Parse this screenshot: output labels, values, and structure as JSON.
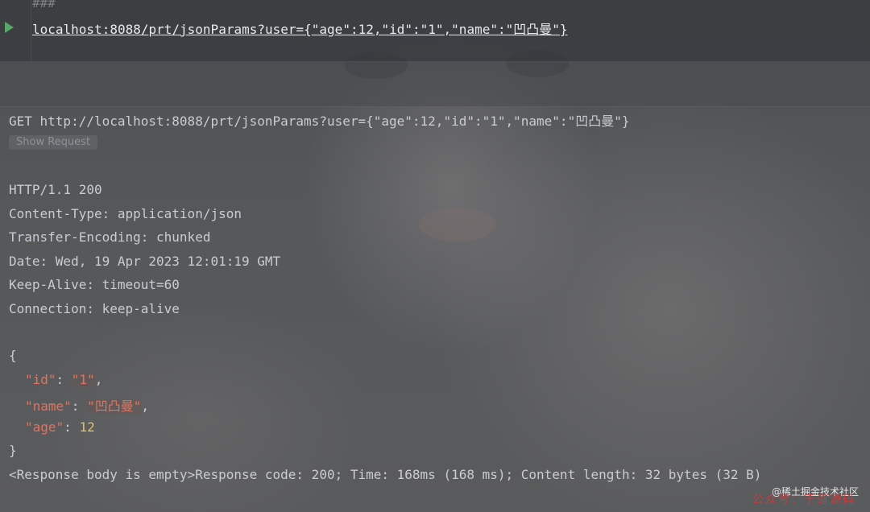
{
  "editor": {
    "comment": "###",
    "request_line": "localhost:8088/prt/jsonParams?user={\"age\":12,\"id\":\"1\",\"name\":\"凹凸曼\"}"
  },
  "response": {
    "request_summary": "GET http://localhost:8088/prt/jsonParams?user={\"age\":12,\"id\":\"1\",\"name\":\"凹凸曼\"}",
    "show_request_label": "Show Request",
    "status_line": "HTTP/1.1 200",
    "headers": [
      "Content-Type: application/json",
      "Transfer-Encoding: chunked",
      "Date: Wed, 19 Apr 2023 12:01:19 GMT",
      "Keep-Alive: timeout=60",
      "Connection: keep-alive"
    ],
    "body": {
      "open_brace": "{",
      "close_brace": "}",
      "fields": [
        {
          "key": "\"id\"",
          "value": "\"1\"",
          "sep": ",",
          "type": "string"
        },
        {
          "key": "\"name\"",
          "value": "\"凹凸曼\"",
          "sep": ",",
          "type": "string"
        },
        {
          "key": "\"age\"",
          "value": "12",
          "sep": "",
          "type": "number"
        }
      ]
    },
    "footer": "<Response body is empty>Response code: 200; Time: 168ms (168 ms); Content length: 32 bytes (32 B)"
  },
  "watermark": {
    "site": "@稀土掘金技术社区",
    "account": "公众号：于道源码"
  },
  "colors": {
    "key": "#e0745e",
    "string": "#e0745e",
    "number": "#d9c46a",
    "run": "#59a869"
  }
}
